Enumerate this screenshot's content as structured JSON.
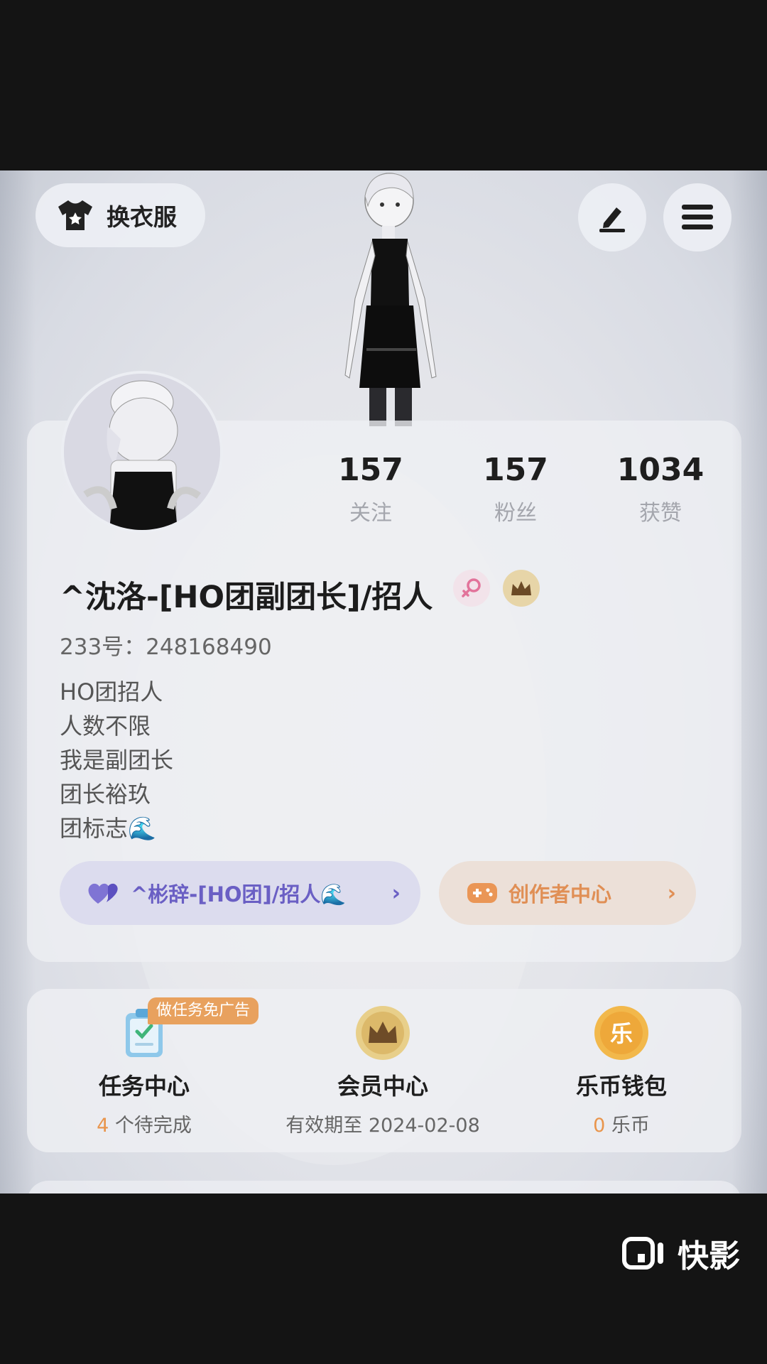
{
  "topbar": {
    "outfit_label": "换衣服"
  },
  "stats": [
    {
      "value": "157",
      "label": "关注"
    },
    {
      "value": "157",
      "label": "粉丝"
    },
    {
      "value": "1034",
      "label": "获赞"
    }
  ],
  "profile": {
    "username": "^沈洛-[HO团副团长]/招人",
    "uid": "233号：248168490",
    "bio": [
      "HO团招人",
      "人数不限",
      "我是副团长",
      "团长裕玖",
      "团标志🌊"
    ]
  },
  "links": {
    "friend_label": "^彬辞-[HO团]/招人🌊",
    "creator_label": "创作者中心"
  },
  "services": {
    "ad_tag": "做任务免广告",
    "tasks": {
      "title": "任务中心",
      "count": "4",
      "suffix": " 个待完成"
    },
    "vip": {
      "title": "会员中心",
      "sub": "有效期至 2024-02-08"
    },
    "wallet": {
      "title": "乐币钱包",
      "count": "0",
      "suffix": " 乐币",
      "icon_char": "乐"
    }
  },
  "watermark": {
    "text": "快影"
  },
  "colors": {
    "friend_accent": "#6a5fc4",
    "creator_accent": "#e08f55",
    "highlight": "#e9954c",
    "vip_gold": "#c9a14f"
  }
}
